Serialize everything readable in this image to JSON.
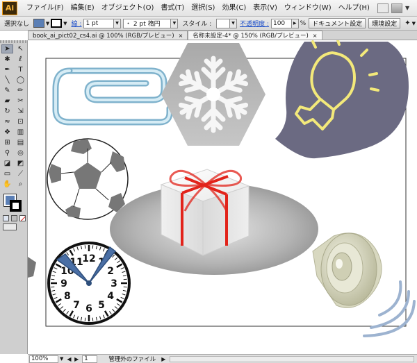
{
  "app": {
    "logo_text": "Ai"
  },
  "menu": {
    "items": [
      "ファイル(F)",
      "編集(E)",
      "オブジェクト(O)",
      "書式(T)",
      "選択(S)",
      "効果(C)",
      "表示(V)",
      "ウィンドウ(W)",
      "ヘルプ(H)"
    ]
  },
  "control": {
    "selection_label": "選択なし",
    "stroke_label": "線 :",
    "stroke_weight": "1 pt",
    "brush": "・ 2 pt 楕円",
    "style_label": "スタイル :",
    "opacity_label": "不透明度 :",
    "opacity_value": "100",
    "opacity_unit": "%",
    "doc_setup_button": "ドキュメント設定",
    "prefs_button": "環境設定"
  },
  "tabs": [
    {
      "label": "book_ai_pict02_cs4.ai @ 100% (RGB/プレビュー)",
      "close": "×",
      "active": false
    },
    {
      "label": "名称未設定-4* @ 150% (RGB/プレビュー)",
      "close": "×",
      "active": true
    }
  ],
  "canvas": {
    "clock_numbers": [
      "12",
      "1",
      "2",
      "3",
      "4",
      "5",
      "6",
      "7",
      "8",
      "9",
      "10",
      "11"
    ],
    "colors": {
      "paperclip": "#9ecbe0",
      "snowflake_bg": "#b8b8b8",
      "bulb_bg": "#6b6a82",
      "bulb_line": "#f3e97a",
      "ribbon": "#e2231a",
      "clock_hands": "#4a6fa5",
      "speaker": "#cfcfb2",
      "waves": "#9db3d0"
    }
  },
  "status": {
    "zoom": "100%",
    "page": "1",
    "page_nav": "◀ ▶",
    "info": "管理外のファイル",
    "arrow": "▶"
  }
}
